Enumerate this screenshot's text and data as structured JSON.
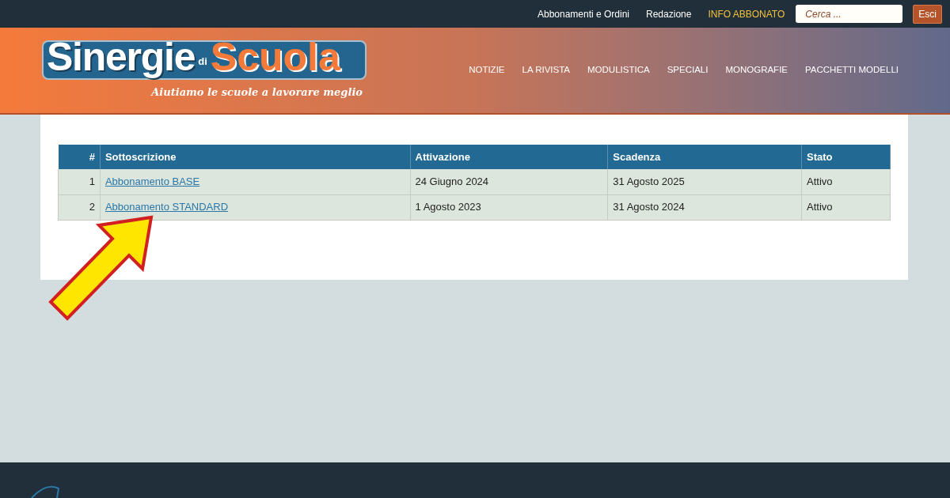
{
  "top_bar": {
    "links": [
      {
        "label": "Abbonamenti e Ordini",
        "kind": "plain"
      },
      {
        "label": "Redazione",
        "kind": "plain"
      },
      {
        "label": "INFO ABBONATO",
        "kind": "highlight"
      }
    ],
    "search": {
      "placeholder": "Cerca ..."
    },
    "logout": "Esci"
  },
  "header": {
    "logo": {
      "word_1": "Sinergie",
      "word_2": "di",
      "word_3": "Scuola",
      "tagline": "Aiutiamo le scuole a lavorare meglio"
    },
    "nav": [
      "NOTIZIE",
      "LA RIVISTA",
      "MODULISTICA",
      "SPECIALI",
      "MONOGRAFIE",
      "PACCHETTI MODELLI"
    ]
  },
  "table": {
    "columns": [
      "#",
      "Sottoscrizione",
      "Attivazione",
      "Scadenza",
      "Stato"
    ],
    "rows": [
      [
        "1",
        "Abbonamento BASE",
        "24 Giugno 2024",
        "31 Agosto 2025",
        "Attivo"
      ],
      [
        "2",
        "Abbonamento STANDARD",
        "1 Agosto 2023",
        "31 Agosto 2024",
        "Attivo"
      ]
    ]
  }
}
